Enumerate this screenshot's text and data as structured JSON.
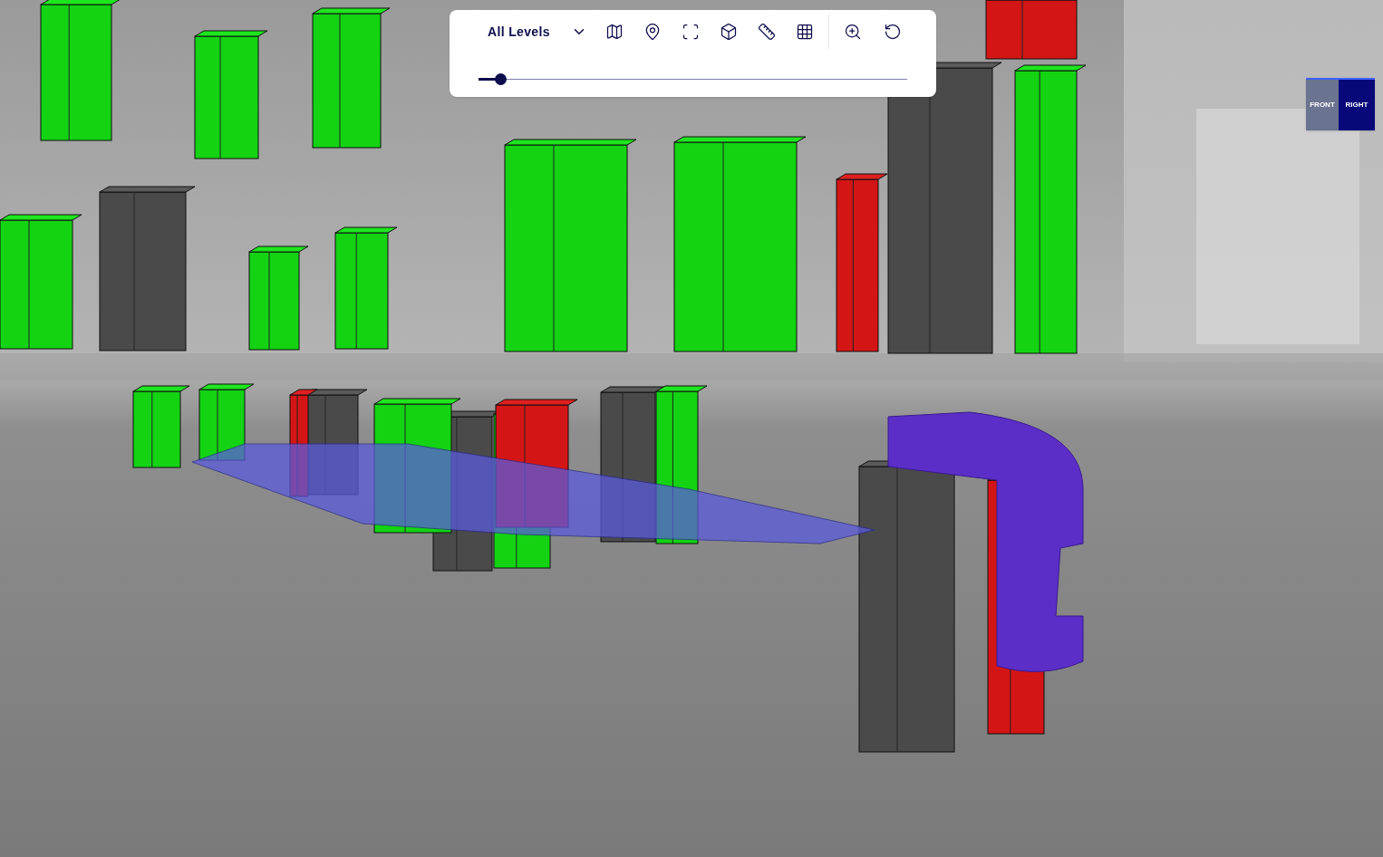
{
  "toolbar": {
    "level_select": {
      "value": "All Levels"
    },
    "slider": {
      "level": 0.05
    }
  },
  "view_cube": {
    "faces": [
      "FRONT",
      "RIGHT"
    ]
  }
}
